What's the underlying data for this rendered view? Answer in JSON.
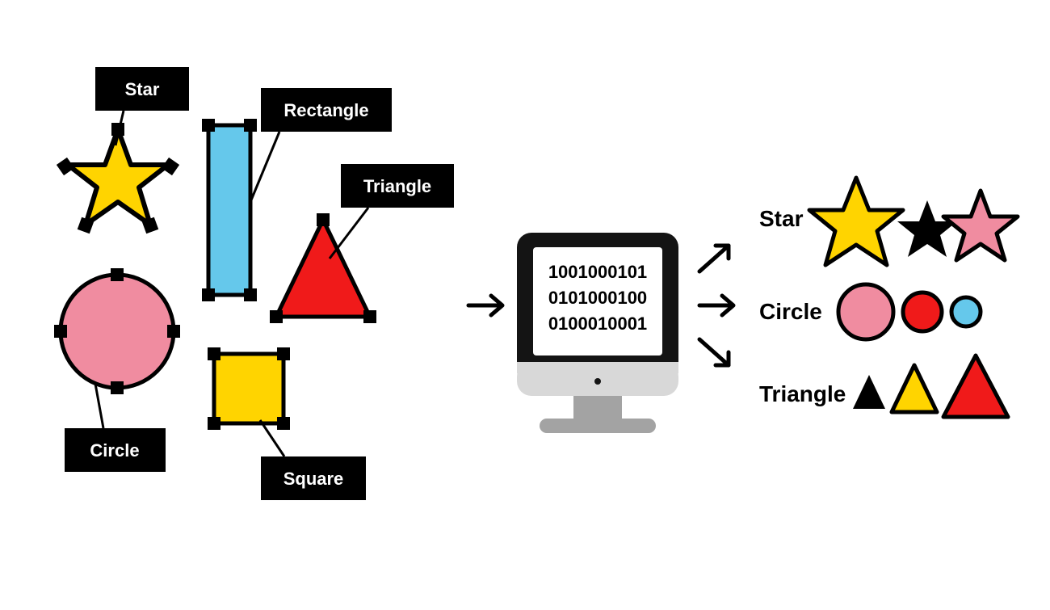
{
  "labels": {
    "star": "Star",
    "rectangle": "Rectangle",
    "triangle": "Triangle",
    "circle": "Circle",
    "square": "Square"
  },
  "binary": {
    "line1": "1001000101",
    "line2": "0101000100",
    "line3": "0100010001"
  },
  "outputs": {
    "star": "Star",
    "circle": "Circle",
    "triangle": "Triangle"
  },
  "colors": {
    "yellow": "#FFD400",
    "red": "#F01A1A",
    "pink": "#F08CA0",
    "blue": "#65C8EB",
    "black": "#000000",
    "monitorDark": "#141414",
    "monitorBase": "#D8D8D8",
    "monitorStand": "#A3A3A3"
  }
}
